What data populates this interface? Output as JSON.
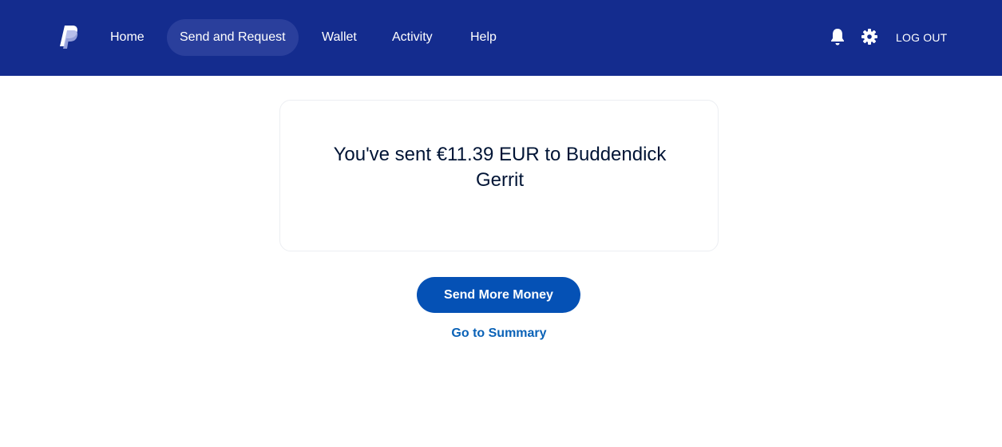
{
  "brand": {
    "logo_icon": "paypal-logo-icon"
  },
  "nav": {
    "items": [
      {
        "label": "Home",
        "active": false
      },
      {
        "label": "Send and Request",
        "active": true
      },
      {
        "label": "Wallet",
        "active": false
      },
      {
        "label": "Activity",
        "active": false
      },
      {
        "label": "Help",
        "active": false
      }
    ],
    "notifications_icon": "bell-icon",
    "settings_icon": "gear-icon",
    "logout_label": "LOG OUT"
  },
  "confirmation": {
    "message": "You've sent €11.39 EUR to Buddendick Gerrit"
  },
  "actions": {
    "send_more_label": "Send More Money",
    "summary_link_label": "Go to Summary"
  },
  "colors": {
    "header_bg": "#142c8e",
    "active_tab_bg": "#2a3f9c",
    "primary_button": "#0551b5",
    "link": "#0a62b7",
    "text_dark": "#001435"
  }
}
